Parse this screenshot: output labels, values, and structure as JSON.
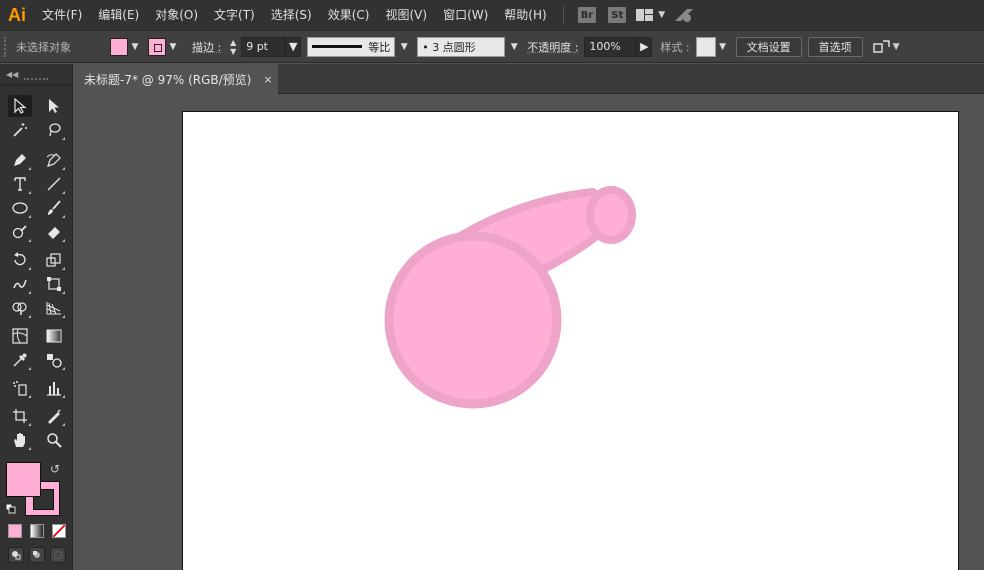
{
  "app": {
    "logo": "Ai"
  },
  "menu": [
    "文件(F)",
    "编辑(E)",
    "对象(O)",
    "文字(T)",
    "选择(S)",
    "效果(C)",
    "视图(V)",
    "窗口(W)",
    "帮助(H)"
  ],
  "menubar_icons": {
    "br": "Br",
    "st": "St"
  },
  "control": {
    "selection_status": "未选择对象",
    "stroke_label": "描边 :",
    "stroke_weight": "9 pt",
    "stroke_profile": "等比",
    "brush": "• 3 点圆形",
    "opacity_label": "不透明度 :",
    "opacity_value": "100%",
    "style_label": "样式 :",
    "doc_setup": "文档设置",
    "preferences": "首选项"
  },
  "colors": {
    "fill": "#ffaed5",
    "stroke": "#eea3c9",
    "artboard": "#ffffff"
  },
  "document": {
    "tab_title": "未标题-7* @ 97% (RGB/预览)",
    "close": "×"
  },
  "icons": [
    "selection-icon",
    "direct-selection-icon",
    "magic-wand-icon",
    "lasso-icon",
    "pen-icon",
    "curvature-icon",
    "type-icon",
    "line-icon",
    "ellipse-icon",
    "paintbrush-icon",
    "shaper-icon",
    "eraser-icon",
    "rotate-icon",
    "scale-icon",
    "warp-icon",
    "free-transform-icon",
    "shape-builder-icon",
    "perspective-grid-icon",
    "mesh-icon",
    "gradient-icon",
    "eyedropper-icon",
    "blend-icon",
    "symbol-sprayer-icon",
    "column-graph-icon",
    "artboard-icon",
    "slice-icon",
    "hand-icon",
    "zoom-icon"
  ]
}
